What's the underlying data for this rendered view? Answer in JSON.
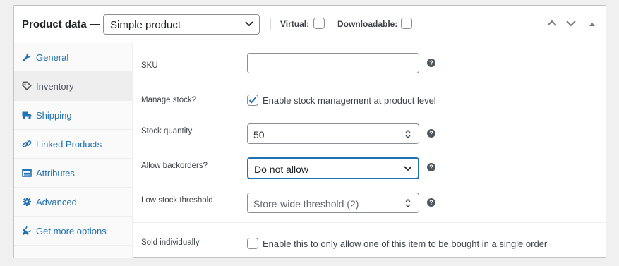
{
  "header": {
    "title": "Product data —",
    "product_type": "Simple product",
    "virtual_label": "Virtual:",
    "downloadable_label": "Downloadable:"
  },
  "sidebar": {
    "tabs": [
      {
        "label": "General",
        "icon": "wrench-icon"
      },
      {
        "label": "Inventory",
        "icon": "tag-icon",
        "active": true
      },
      {
        "label": "Shipping",
        "icon": "truck-icon"
      },
      {
        "label": "Linked Products",
        "icon": "link-icon"
      },
      {
        "label": "Attributes",
        "icon": "list-table-icon"
      },
      {
        "label": "Advanced",
        "icon": "gear-icon"
      },
      {
        "label": "Get more options",
        "icon": "plugin-icon"
      }
    ]
  },
  "inventory": {
    "sku_label": "SKU",
    "sku_value": "",
    "manage_stock_label": "Manage stock?",
    "manage_stock_text": "Enable stock management at product level",
    "manage_stock_checked": true,
    "stock_qty_label": "Stock quantity",
    "stock_qty_value": "50",
    "backorders_label": "Allow backorders?",
    "backorders_value": "Do not allow",
    "low_stock_label": "Low stock threshold",
    "low_stock_placeholder": "Store-wide threshold (2)",
    "sold_individually_label": "Sold individually",
    "sold_individually_text": "Enable this to only allow one of this item to be bought in a single order",
    "help_glyph": "?"
  },
  "colors": {
    "accent": "#2271b1",
    "text": "#1d2327",
    "border": "#c3c4c7"
  }
}
